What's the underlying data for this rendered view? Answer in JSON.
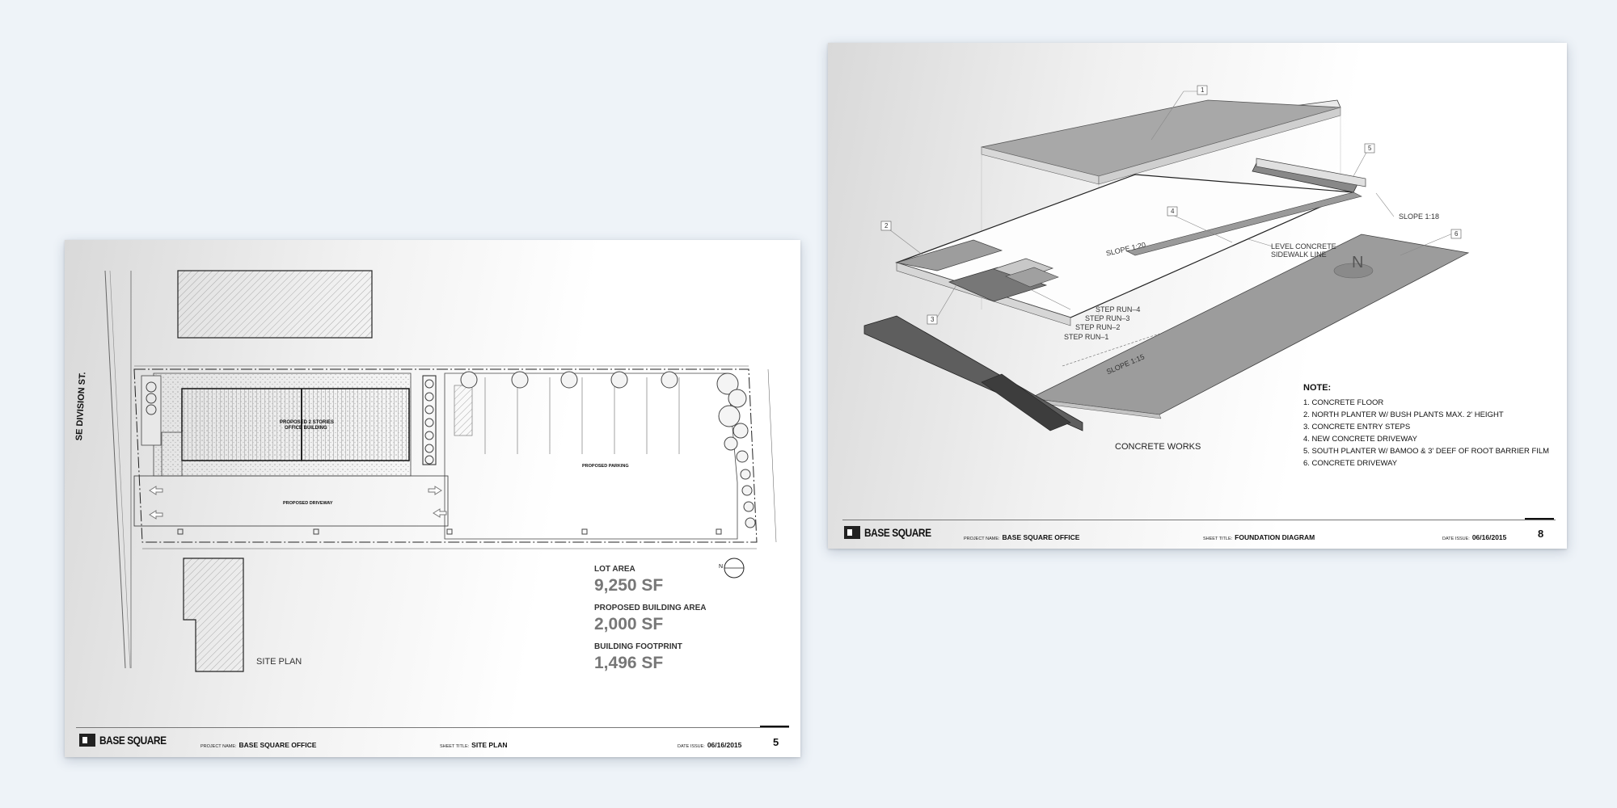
{
  "sheets": [
    {
      "street": "SE DIVISION ST.",
      "building_label_1": "PROPOSED 2 STORIES",
      "building_label_2": "OFFICE BUILDING",
      "parking_label": "PROPOSED PARKING",
      "driveway_label": "PROPOSED DRIVEWAY",
      "title": "SITE PLAN",
      "stats": [
        {
          "label": "LOT AREA",
          "value": "9,250 SF"
        },
        {
          "label": "PROPOSED BUILDING AREA",
          "value": "2,000 SF"
        },
        {
          "label": "BUILDING FOOTPRINT",
          "value": "1,496 SF"
        }
      ],
      "north": "N",
      "titleblock": {
        "logo": "BASE SQUARE",
        "project_label": "PROJECT NAME:",
        "project_value": "BASE SQUARE OFFICE",
        "sheet_label": "SHEET TITLE:",
        "sheet_value": "SITE PLAN",
        "date_label": "DATE ISSUE:",
        "date_value": "06/16/2015",
        "sheet_number": "5"
      }
    },
    {
      "callouts": [
        "1",
        "2",
        "3",
        "4",
        "5",
        "6"
      ],
      "labels": {
        "slope_120": "SLOPE 1:20",
        "slope_118": "SLOPE 1:18",
        "slope_115": "SLOPE 1:15",
        "level_1": "LEVEL CONCRETE",
        "level_2": "SIDEWALK LINE",
        "step4": "STEP RUN–4",
        "step3": "STEP RUN–3",
        "step2": "STEP RUN–2",
        "step1": "STEP RUN–1",
        "north": "N"
      },
      "title": "CONCRETE WORKS",
      "note_title": "NOTE:",
      "notes": [
        "1. CONCRETE FLOOR",
        "2. NORTH PLANTER W/ BUSH PLANTS MAX. 2' HEIGHT",
        "3. CONCRETE ENTRY STEPS",
        "4. NEW CONCRETE DRIVEWAY",
        "5. SOUTH PLANTER W/ BAMOO & 3' DEEF OF ROOT BARRIER FILM",
        "6. CONCRETE DRIVEWAY"
      ],
      "titleblock": {
        "logo": "BASE SQUARE",
        "project_label": "PROJECT NAME:",
        "project_value": "BASE SQUARE OFFICE",
        "sheet_label": "SHEET TITLE:",
        "sheet_value": "FOUNDATION DIAGRAM",
        "date_label": "DATE ISSUE:",
        "date_value": "06/16/2015",
        "sheet_number": "8"
      }
    }
  ]
}
